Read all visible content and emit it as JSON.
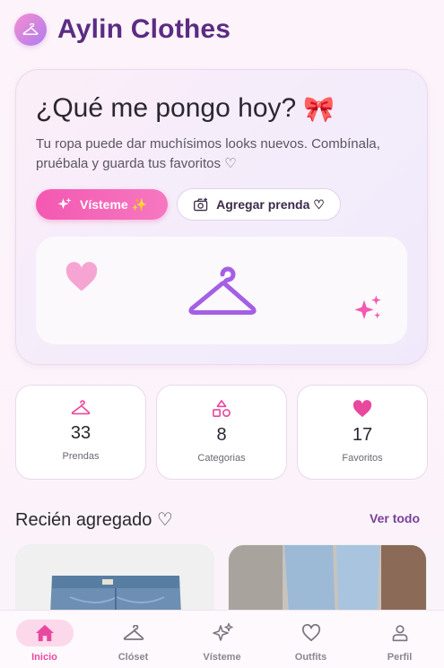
{
  "app": {
    "title": "Aylin Clothes",
    "logo_icon": "hanger-icon",
    "accent": "#f458b2",
    "brand": "#5b2c83"
  },
  "hero": {
    "title": "¿Qué me pongo hoy?",
    "title_emoji": "🎀",
    "subtitle": "Tu ropa puede dar muchísimos looks nuevos. Combínala, pruébala y guarda tus favoritos ♡",
    "primary_button": {
      "label": "Vísteme ✨",
      "icon": "sparkles-icon"
    },
    "secondary_button": {
      "label": "Agregar prenda ♡",
      "icon": "camera-plus-icon"
    }
  },
  "stats": [
    {
      "value": "33",
      "label": "Prendas",
      "icon": "hanger-icon",
      "color": "#e9489f"
    },
    {
      "value": "8",
      "label": "Categorias",
      "icon": "shapes-icon",
      "color": "#e9489f"
    },
    {
      "value": "17",
      "label": "Favoritos",
      "icon": "heart-icon",
      "color": "#e9489f"
    }
  ],
  "recent": {
    "title": "Recién agregado ♡",
    "see_all": "Ver todo"
  },
  "nav": [
    {
      "label": "Inicio",
      "icon": "home-icon",
      "active": true
    },
    {
      "label": "Clóset",
      "icon": "hanger-icon",
      "active": false
    },
    {
      "label": "Vísteme",
      "icon": "sparkles-icon",
      "active": false
    },
    {
      "label": "Outfits",
      "icon": "heart-outline-icon",
      "active": false
    },
    {
      "label": "Perfil",
      "icon": "person-icon",
      "active": false
    }
  ]
}
